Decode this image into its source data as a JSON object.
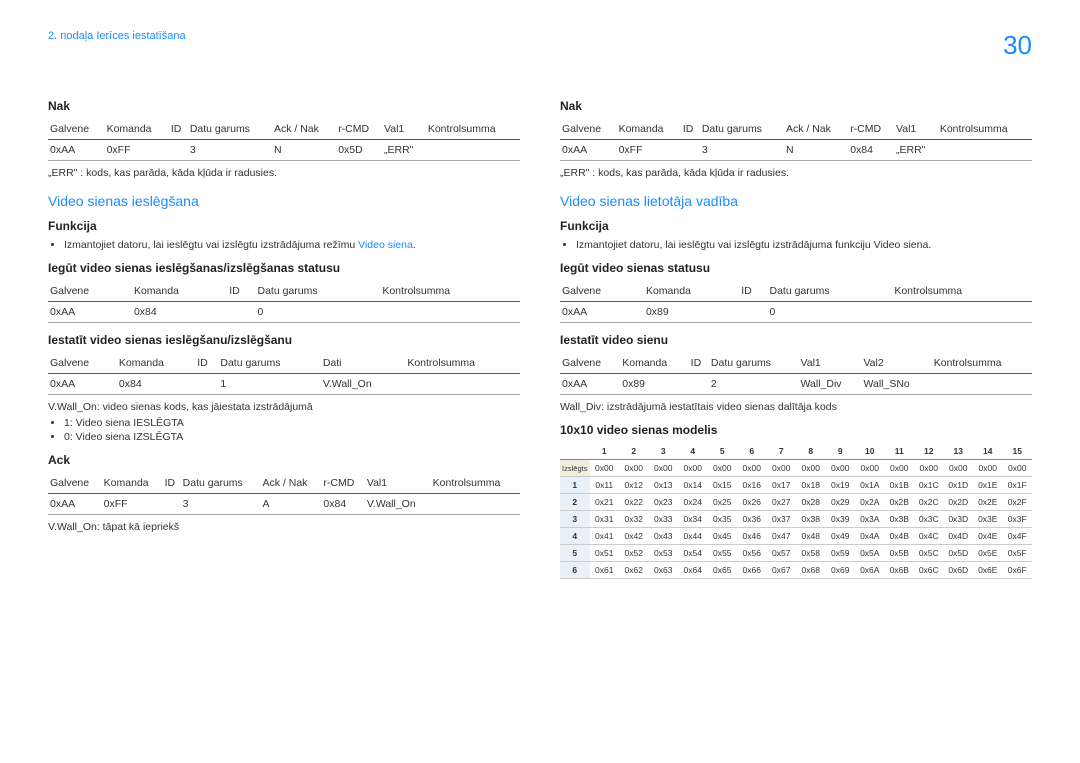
{
  "header": {
    "chapter": "2. nodaļa Ierīces iestatīšana",
    "page": "30"
  },
  "left": {
    "nak": {
      "title": "Nak",
      "cols": [
        "Galvene",
        "Komanda",
        "ID",
        "Datu garums",
        "Ack / Nak",
        "r-CMD",
        "Val1",
        "Kontrolsumma"
      ],
      "row": [
        "0xAA",
        "0xFF",
        "",
        "3",
        "N",
        "0x5D",
        "„ERR\"",
        ""
      ],
      "note": "„ERR\" : kods, kas parāda, kāda kļūda ir radusies."
    },
    "enable_section": {
      "title": "Video sienas ieslēgšana",
      "func_label": "Funkcija",
      "func_text_prefix": "Izmantojiet datoru, lai ieslēgtu vai izslēgtu izstrādājuma režīmu ",
      "func_link": "Video siena",
      "func_text_suffix": ".",
      "get_status_title": "Iegūt video sienas ieslēgšanas/izslēgšanas statusu",
      "get_status_cols": [
        "Galvene",
        "Komanda",
        "ID",
        "Datu garums",
        "Kontrolsumma"
      ],
      "get_status_row": [
        "0xAA",
        "0x84",
        "",
        "0",
        ""
      ],
      "set_title": "Iestatīt video sienas ieslēgšanu/izslēgšanu",
      "set_cols": [
        "Galvene",
        "Komanda",
        "ID",
        "Datu garums",
        "Dati",
        "Kontrolsumma"
      ],
      "set_row": [
        "0xAA",
        "0x84",
        "",
        "1",
        "V.Wall_On",
        ""
      ],
      "set_note": "V.Wall_On: video sienas kods, kas jāiestata izstrādājumā",
      "set_opts": [
        "1: Video siena IESLĒGTA",
        "0: Video siena IZSLĒGTA"
      ],
      "ack_title": "Ack",
      "ack_cols": [
        "Galvene",
        "Komanda",
        "ID",
        "Datu garums",
        "Ack / Nak",
        "r-CMD",
        "Val1",
        "Kontrolsumma"
      ],
      "ack_row": [
        "0xAA",
        "0xFF",
        "",
        "3",
        "A",
        "0x84",
        "V.Wall_On",
        ""
      ],
      "ack_note": "V.Wall_On: tāpat kā iepriekš"
    }
  },
  "right": {
    "nak": {
      "title": "Nak",
      "cols": [
        "Galvene",
        "Komanda",
        "ID",
        "Datu garums",
        "Ack / Nak",
        "r-CMD",
        "Val1",
        "Kontrolsumma"
      ],
      "row": [
        "0xAA",
        "0xFF",
        "",
        "3",
        "N",
        "0x84",
        "„ERR\"",
        ""
      ],
      "note": "„ERR\" : kods, kas parāda, kāda kļūda ir radusies."
    },
    "user_section": {
      "title": "Video sienas lietotāja vadība",
      "func_label": "Funkcija",
      "func_text": "Izmantojiet datoru, lai ieslēgtu vai izslēgtu izstrādājuma funkciju Video siena.",
      "get_status_title": "Iegūt video sienas statusu",
      "get_status_cols": [
        "Galvene",
        "Komanda",
        "ID",
        "Datu garums",
        "Kontrolsumma"
      ],
      "get_status_row": [
        "0xAA",
        "0x89",
        "",
        "0",
        ""
      ],
      "set_title": "Iestatīt video sienu",
      "set_cols": [
        "Galvene",
        "Komanda",
        "ID",
        "Datu garums",
        "Val1",
        "Val2",
        "Kontrolsumma"
      ],
      "set_row": [
        "0xAA",
        "0x89",
        "",
        "2",
        "Wall_Div",
        "Wall_SNo",
        ""
      ],
      "set_note": "Wall_Div: izstrādājumā iestatītais video sienas dalītāja kods",
      "matrix_title": "10x10 video sienas modelis",
      "matrix_off_label": "Izslēgts",
      "matrix_cols": [
        "1",
        "2",
        "3",
        "4",
        "5",
        "6",
        "7",
        "8",
        "9",
        "10",
        "11",
        "12",
        "13",
        "14",
        "15"
      ],
      "matrix_rows": [
        {
          "h": "",
          "v": [
            "0x00",
            "0x00",
            "0x00",
            "0x00",
            "0x00",
            "0x00",
            "0x00",
            "0x00",
            "0x00",
            "0x00",
            "0x00",
            "0x00",
            "0x00",
            "0x00",
            "0x00"
          ]
        },
        {
          "h": "1",
          "v": [
            "0x11",
            "0x12",
            "0x13",
            "0x14",
            "0x15",
            "0x16",
            "0x17",
            "0x18",
            "0x19",
            "0x1A",
            "0x1B",
            "0x1C",
            "0x1D",
            "0x1E",
            "0x1F"
          ]
        },
        {
          "h": "2",
          "v": [
            "0x21",
            "0x22",
            "0x23",
            "0x24",
            "0x25",
            "0x26",
            "0x27",
            "0x28",
            "0x29",
            "0x2A",
            "0x2B",
            "0x2C",
            "0x2D",
            "0x2E",
            "0x2F"
          ]
        },
        {
          "h": "3",
          "v": [
            "0x31",
            "0x32",
            "0x33",
            "0x34",
            "0x35",
            "0x36",
            "0x37",
            "0x38",
            "0x39",
            "0x3A",
            "0x3B",
            "0x3C",
            "0x3D",
            "0x3E",
            "0x3F"
          ]
        },
        {
          "h": "4",
          "v": [
            "0x41",
            "0x42",
            "0x43",
            "0x44",
            "0x45",
            "0x46",
            "0x47",
            "0x48",
            "0x49",
            "0x4A",
            "0x4B",
            "0x4C",
            "0x4D",
            "0x4E",
            "0x4F"
          ]
        },
        {
          "h": "5",
          "v": [
            "0x51",
            "0x52",
            "0x53",
            "0x54",
            "0x55",
            "0x56",
            "0x57",
            "0x58",
            "0x59",
            "0x5A",
            "0x5B",
            "0x5C",
            "0x5D",
            "0x5E",
            "0x5F"
          ]
        },
        {
          "h": "6",
          "v": [
            "0x61",
            "0x62",
            "0x63",
            "0x64",
            "0x65",
            "0x66",
            "0x67",
            "0x68",
            "0x69",
            "0x6A",
            "0x6B",
            "0x6C",
            "0x6D",
            "0x6E",
            "0x6F"
          ]
        }
      ]
    }
  }
}
